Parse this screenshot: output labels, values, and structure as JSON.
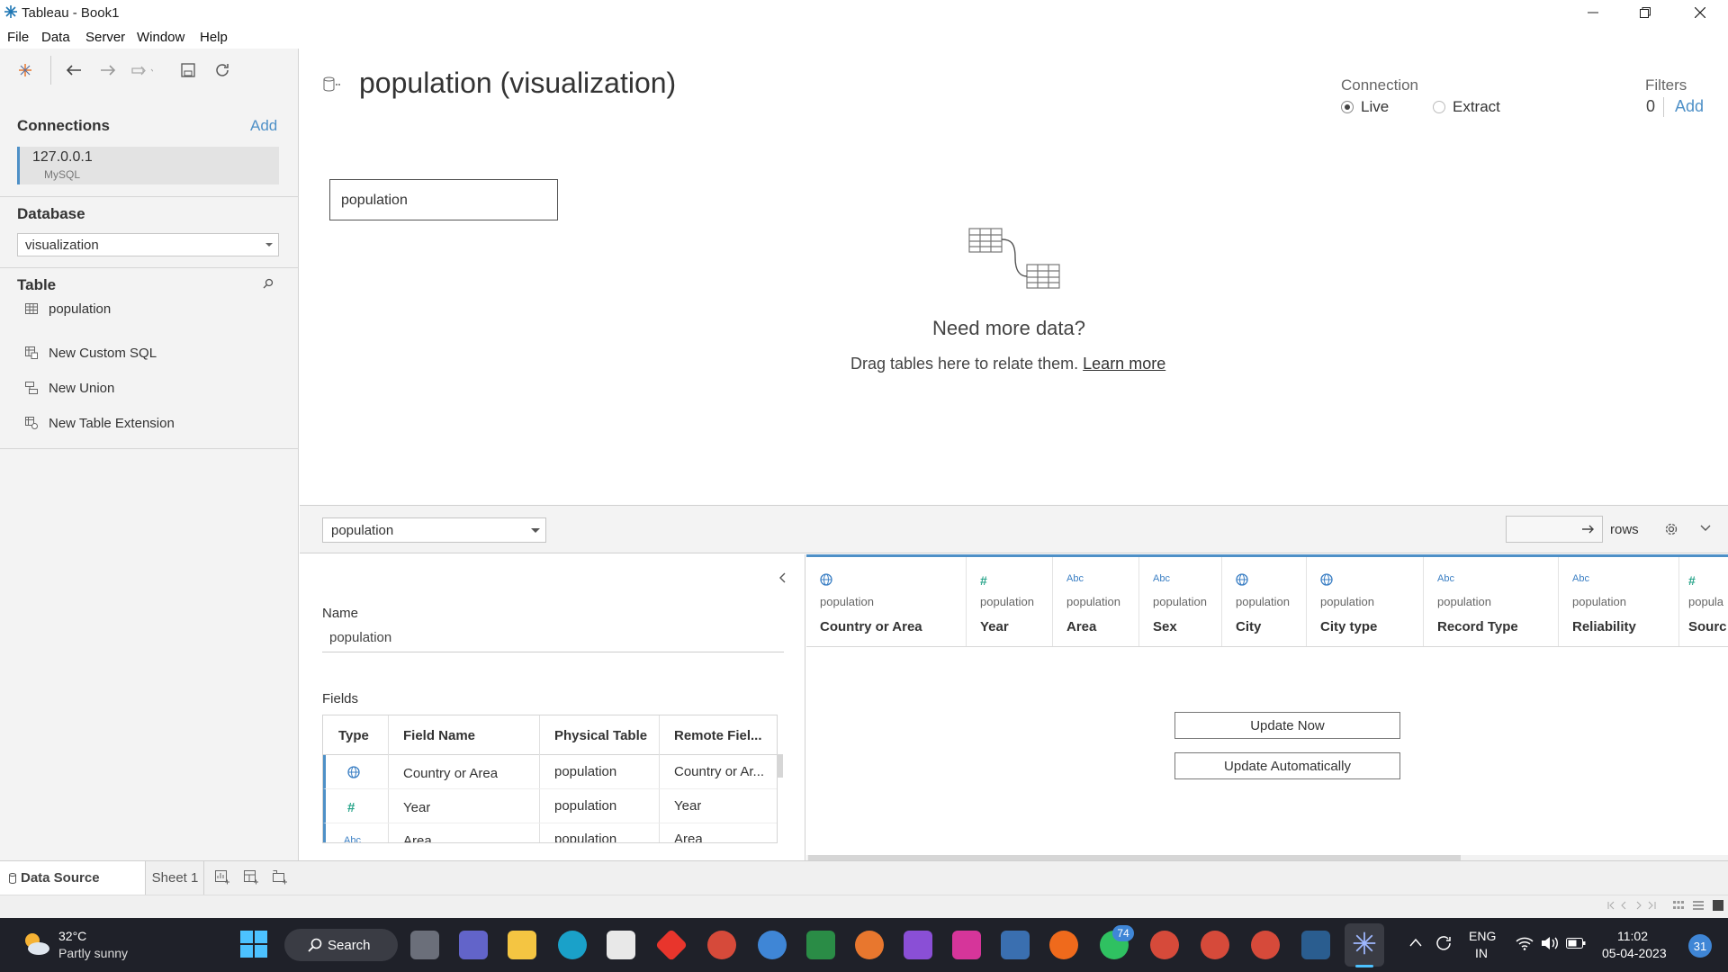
{
  "window": {
    "title": "Tableau - Book1"
  },
  "menu": [
    "File",
    "Data",
    "Server",
    "Window",
    "Help"
  ],
  "sidebar": {
    "connections_title": "Connections",
    "add_label": "Add",
    "connection": {
      "host": "127.0.0.1",
      "type": "MySQL"
    },
    "database_title": "Database",
    "database_value": "visualization",
    "table_title": "Table",
    "tables": [
      "population"
    ],
    "actions": [
      "New Custom SQL",
      "New Union",
      "New Table Extension"
    ]
  },
  "canvas": {
    "title": "population (visualization)",
    "connection_label": "Connection",
    "live_label": "Live",
    "extract_label": "Extract",
    "filters_label": "Filters",
    "filters_count": "0",
    "filters_add": "Add",
    "table_box": "population",
    "need_more": "Need more data?",
    "drag_text": "Drag tables here to relate them.",
    "learn_more": "Learn more"
  },
  "toolbar": {
    "table_select": "population",
    "rows_label": "rows"
  },
  "meta": {
    "name_label": "Name",
    "name_value": "population",
    "fields_label": "Fields",
    "headers": [
      "Type",
      "Field Name",
      "Physical Table",
      "Remote Fiel..."
    ],
    "rows": [
      {
        "type": "globe",
        "field": "Country or Area",
        "table": "population",
        "remote": "Country or Ar..."
      },
      {
        "type": "number",
        "field": "Year",
        "table": "population",
        "remote": "Year"
      },
      {
        "type": "string",
        "field": "Area",
        "table": "population",
        "remote": "Area"
      }
    ]
  },
  "grid": {
    "columns": [
      {
        "type": "globe",
        "src": "population",
        "name": "Country or Area"
      },
      {
        "type": "number",
        "src": "population",
        "name": "Year"
      },
      {
        "type": "string",
        "src": "population",
        "name": "Area"
      },
      {
        "type": "string",
        "src": "population",
        "name": "Sex"
      },
      {
        "type": "globe",
        "src": "population",
        "name": "City"
      },
      {
        "type": "globe",
        "src": "population",
        "name": "City type"
      },
      {
        "type": "string",
        "src": "population",
        "name": "Record Type"
      },
      {
        "type": "string",
        "src": "population",
        "name": "Reliability"
      },
      {
        "type": "number",
        "src": "popula",
        "name": "Sourc"
      }
    ],
    "type_glyphs": {
      "string": "Abc",
      "number": "#"
    },
    "update_now": "Update Now",
    "update_auto": "Update Automatically"
  },
  "tabs": {
    "data_source": "Data Source",
    "sheet1": "Sheet 1"
  },
  "taskbar": {
    "weather_temp": "32°C",
    "weather_desc": "Partly sunny",
    "search": "Search",
    "whatsapp_badge": "74",
    "lang1": "ENG",
    "lang2": "IN",
    "time": "11:02",
    "date": "05-04-2023",
    "notif": "31"
  },
  "colors": {
    "accent": "#4e90c7",
    "link": "#4e90c7",
    "taskbar": "#1f2129",
    "number_type": "#2aa58b",
    "globe_type": "#3b7fc4"
  }
}
